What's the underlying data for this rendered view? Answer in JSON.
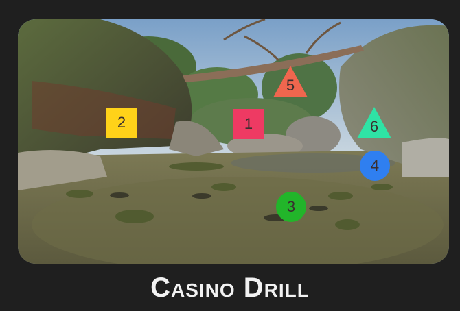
{
  "title": "Casino Drill",
  "targets": [
    {
      "id": "1",
      "label": "1",
      "shape": "square",
      "color": "#ee3a63"
    },
    {
      "id": "2",
      "label": "2",
      "shape": "square",
      "color": "#ffd219"
    },
    {
      "id": "3",
      "label": "3",
      "shape": "circle",
      "color": "#22b52a"
    },
    {
      "id": "4",
      "label": "4",
      "shape": "circle",
      "color": "#2f7ff0"
    },
    {
      "id": "5",
      "label": "5",
      "shape": "triangle",
      "color": "#f0664e"
    },
    {
      "id": "6",
      "label": "6",
      "shape": "triangle",
      "color": "#2fe3a5"
    }
  ]
}
